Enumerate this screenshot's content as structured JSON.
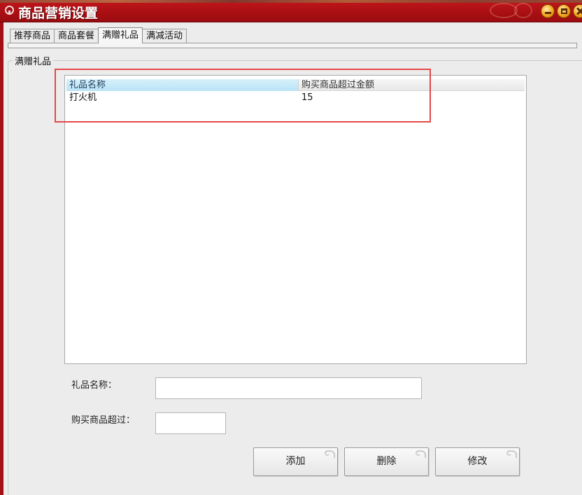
{
  "window": {
    "title": "商品营销设置"
  },
  "tabs": [
    {
      "label": "推荐商品",
      "active": false
    },
    {
      "label": "商品套餐",
      "active": false
    },
    {
      "label": "满赠礼品",
      "active": true
    },
    {
      "label": "满减活动",
      "active": false
    }
  ],
  "group": {
    "label": "满赠礼品"
  },
  "list": {
    "columns": [
      "礼品名称",
      "购买商品超过金额"
    ],
    "rows": [
      [
        "打火机",
        "15"
      ]
    ]
  },
  "form": {
    "gift_name_label": "礼品名称：",
    "gift_name_value": "",
    "amount_label": "购买商品超过：",
    "amount_value": ""
  },
  "buttons": {
    "add": "添加",
    "delete": "删除",
    "edit": "修改"
  },
  "colors": {
    "titlebar": "#a31014",
    "annotation": "#e54848",
    "header_selected": "#b9e3f6"
  },
  "icons": [
    "app-icon",
    "minimize-icon",
    "maximize-icon",
    "close-icon"
  ]
}
